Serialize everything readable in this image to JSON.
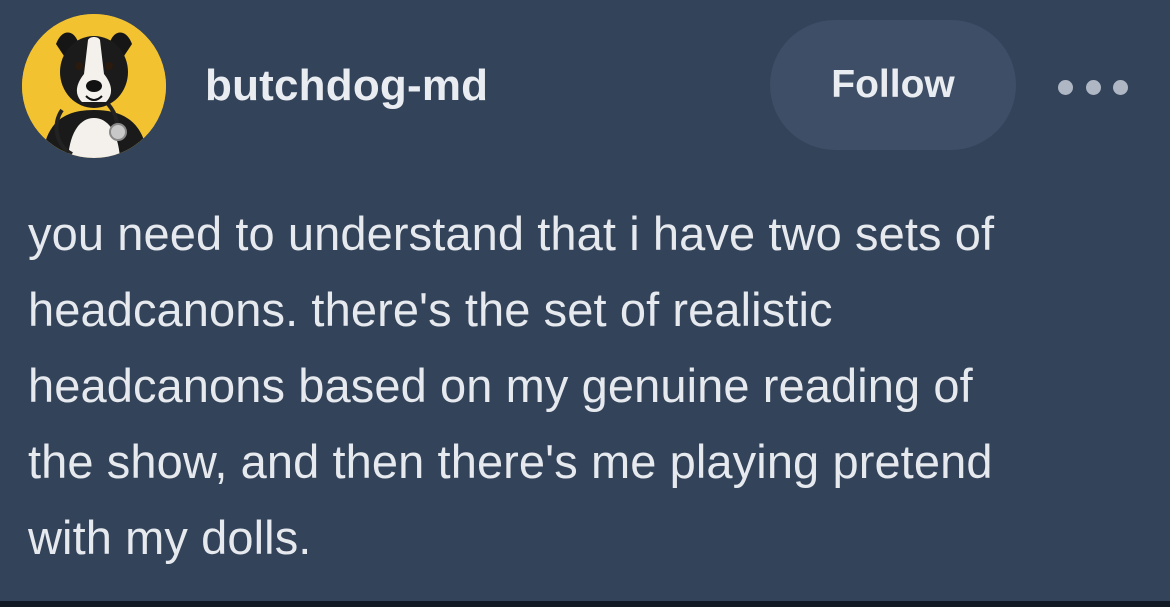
{
  "post": {
    "username": "butchdog-md",
    "follow_label": "Follow",
    "more_icon": "more-horizontal-icon",
    "avatar_icon": "dog-avatar-icon",
    "body_lines": [
      "you need to understand that i have two sets of",
      "headcanons. there's the set of realistic",
      "headcanons based on my genuine reading of",
      "the show, and then there's me playing pretend",
      "with my dolls."
    ]
  },
  "colors": {
    "background": "#33435a",
    "follow_button": "#3d4e66",
    "avatar_background": "#f2c230",
    "text": "#e6e9ee"
  }
}
